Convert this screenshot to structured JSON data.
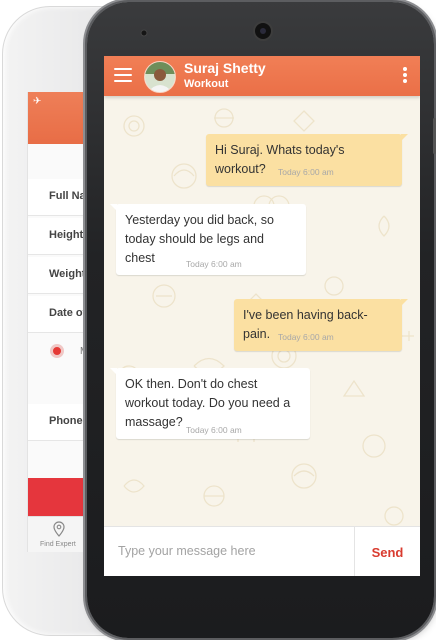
{
  "back_app": {
    "fields": [
      "Full Na",
      "Height",
      "Weight",
      "Date of",
      "Phone N"
    ],
    "radio_label": "M",
    "nav_label": "Find Expert"
  },
  "chat": {
    "contact": {
      "name": "Suraj Shetty",
      "status": "Workout"
    },
    "messages": [
      {
        "direction": "outgoing",
        "text": "Hi Suraj. Whats today's workout?",
        "time": "Today 6:00 am"
      },
      {
        "direction": "incoming",
        "text": "Yesterday you did back, so today should be legs and chest",
        "time": "Today 6:00 am"
      },
      {
        "direction": "outgoing",
        "text": "I've been having back-pain.",
        "time": "Today 6:00 am"
      },
      {
        "direction": "incoming",
        "text": "OK then. Don't do chest workout today. Do you need a massage?",
        "time": "Today 6:00 am"
      }
    ],
    "composer": {
      "placeholder": "Type your message here",
      "send_label": "Send"
    }
  },
  "colors": {
    "header": "#ea6f47",
    "outgoing_bubble": "#fbe0a2",
    "incoming_bubble": "#ffffff",
    "send": "#d93b2f",
    "back_accent": "#e5363d"
  },
  "icons": [
    "menu-icon",
    "more-vertical-icon",
    "airplane-icon",
    "location-pin-icon"
  ]
}
